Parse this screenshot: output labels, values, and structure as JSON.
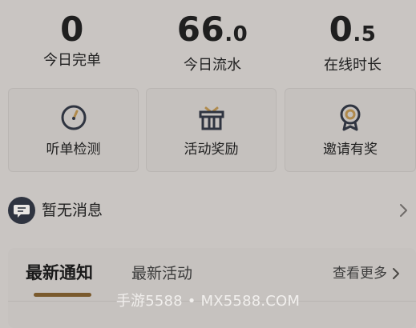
{
  "stats": {
    "orders": {
      "value": "0",
      "label": "今日完单"
    },
    "revenue": {
      "value_int": "66",
      "value_frac": ".0",
      "label": "今日流水"
    },
    "online": {
      "value_int": "0",
      "value_frac": ".5",
      "label": "在线时长"
    }
  },
  "tiles": [
    {
      "label": "听单检测",
      "icon": "gauge-icon"
    },
    {
      "label": "活动奖励",
      "icon": "gift-icon"
    },
    {
      "label": "邀请有奖",
      "icon": "award-medal-icon"
    }
  ],
  "message": {
    "text": "暂无消息",
    "icon": "message-bubble-icon"
  },
  "notice": {
    "tab_active": "最新通知",
    "tab_other": "最新活动",
    "more": "查看更多"
  },
  "watermark": "手游5588 • MX5588.COM",
  "colors": {
    "background": "#c9c5c2",
    "accent": "#7a5a2d",
    "icon_dark": "#2f3440",
    "medal_gold": "#b08a4c"
  }
}
